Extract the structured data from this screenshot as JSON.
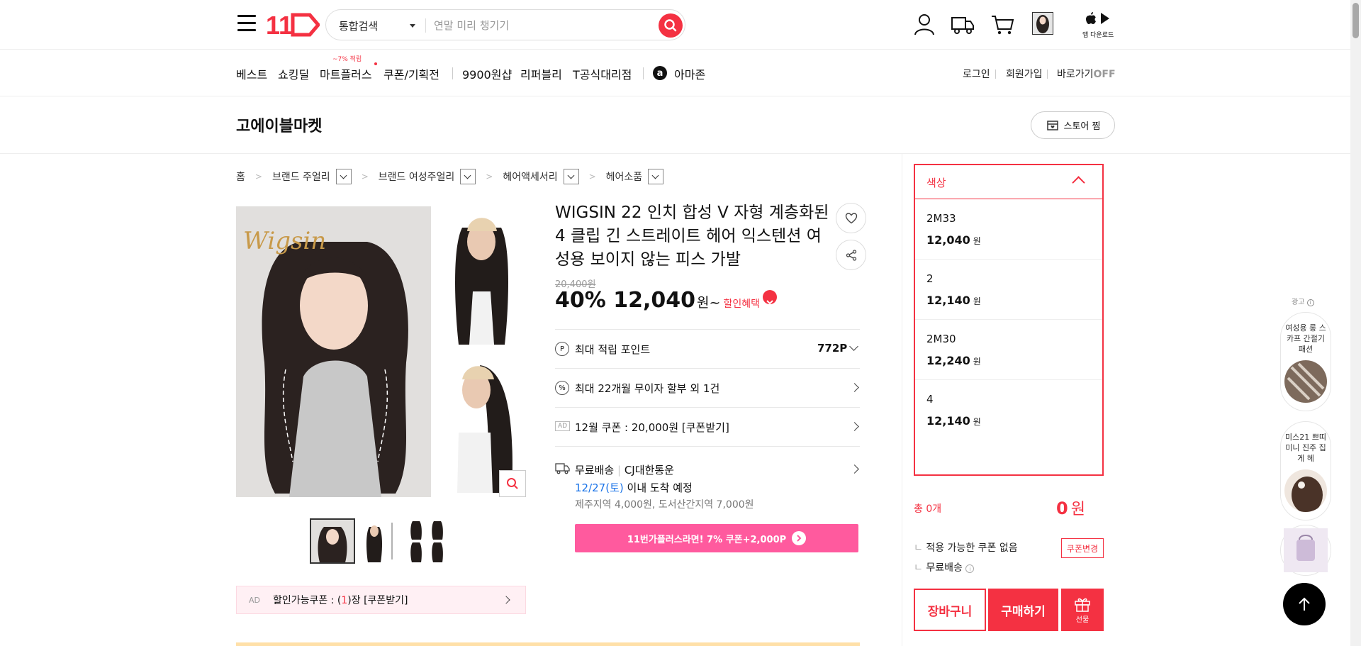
{
  "header": {
    "search": {
      "category": "통합검색",
      "placeholder": "연말 미리 챙기기"
    },
    "logo_text": "11",
    "app_download_label": "앱 다운로드"
  },
  "gnb": {
    "items": [
      "베스트",
      "쇼킹딜",
      "마트플러스",
      "쿠폰/기획전",
      "9900원샵",
      "리퍼블리",
      "T공식대리점",
      "아마존"
    ],
    "mart_badge": "~7% 적립",
    "right": [
      "로그인",
      "회원가입"
    ],
    "shortcut": {
      "label": "바로가기",
      "state": "OFF"
    }
  },
  "store": {
    "name": "고에이블마켓",
    "wish_label": "스토어 찜"
  },
  "breadcrumb": [
    "홈",
    "브랜드 주얼리",
    "브랜드 여성주얼리",
    "헤어액세서리",
    "헤어소품"
  ],
  "product": {
    "title": "WIGSIN 22 인치 합성 V 자형 계층화된 4 클립 긴 스트레이트 헤어 익스텐션 여성용 보이지 않는 피스 가발",
    "brand_watermark": "Wigsin",
    "original_price": "20,400원",
    "discount": "40%",
    "price": "12,040",
    "price_unit": "원",
    "price_tilde": "~",
    "benefit_label": "할인혜택",
    "points": {
      "label": "최대 적립 포인트",
      "value": "772P"
    },
    "installment": "최대 22개월 무이자 할부 외 1건",
    "coupon_row": {
      "ad": "AD",
      "text": "12월 쿠폰 : 20,000원 [쿠폰받기]"
    },
    "shipping": {
      "free": "무료배송",
      "sep": "|",
      "carrier": "CJ대한통운",
      "arrive_date": "12/27(토)",
      "arrive_text": "이내 도착 예정",
      "extra": "제주지역 4,000원, 도서산간지역 7,000원"
    },
    "plus_banner": "11번가플러스라면! 7% 쿠폰+2,000P",
    "discount_coupon": {
      "ad": "AD",
      "text_a": "할인가능쿠폰 : (",
      "count": "1",
      "text_b": ")장 [쿠폰받기]"
    }
  },
  "options": {
    "header": "색상",
    "items": [
      {
        "name": "2M33",
        "price": "12,040",
        "unit": "원"
      },
      {
        "name": "2",
        "price": "12,140",
        "unit": "원"
      },
      {
        "name": "2M30",
        "price": "12,240",
        "unit": "원"
      },
      {
        "name": "4",
        "price": "12,140",
        "unit": "원"
      }
    ]
  },
  "order": {
    "total_label": "총 0개",
    "total_value": "0",
    "total_unit": "원",
    "coupon_none": "적용 가능한 쿠폰 없음",
    "coupon_change": "쿠폰변경",
    "free_shipping": "무료배송",
    "cart": "장바구니",
    "buy": "구매하기",
    "gift": "선물"
  },
  "ads": {
    "label": "광고",
    "cards": [
      "여성용 롱 스카프 간절기 패션",
      "미스21 쁘띠 미니 진주 집게 헤"
    ]
  },
  "colors": {
    "accent": "#f43142",
    "plus": "#ff5a9e",
    "date_blue": "#1a73e8"
  }
}
